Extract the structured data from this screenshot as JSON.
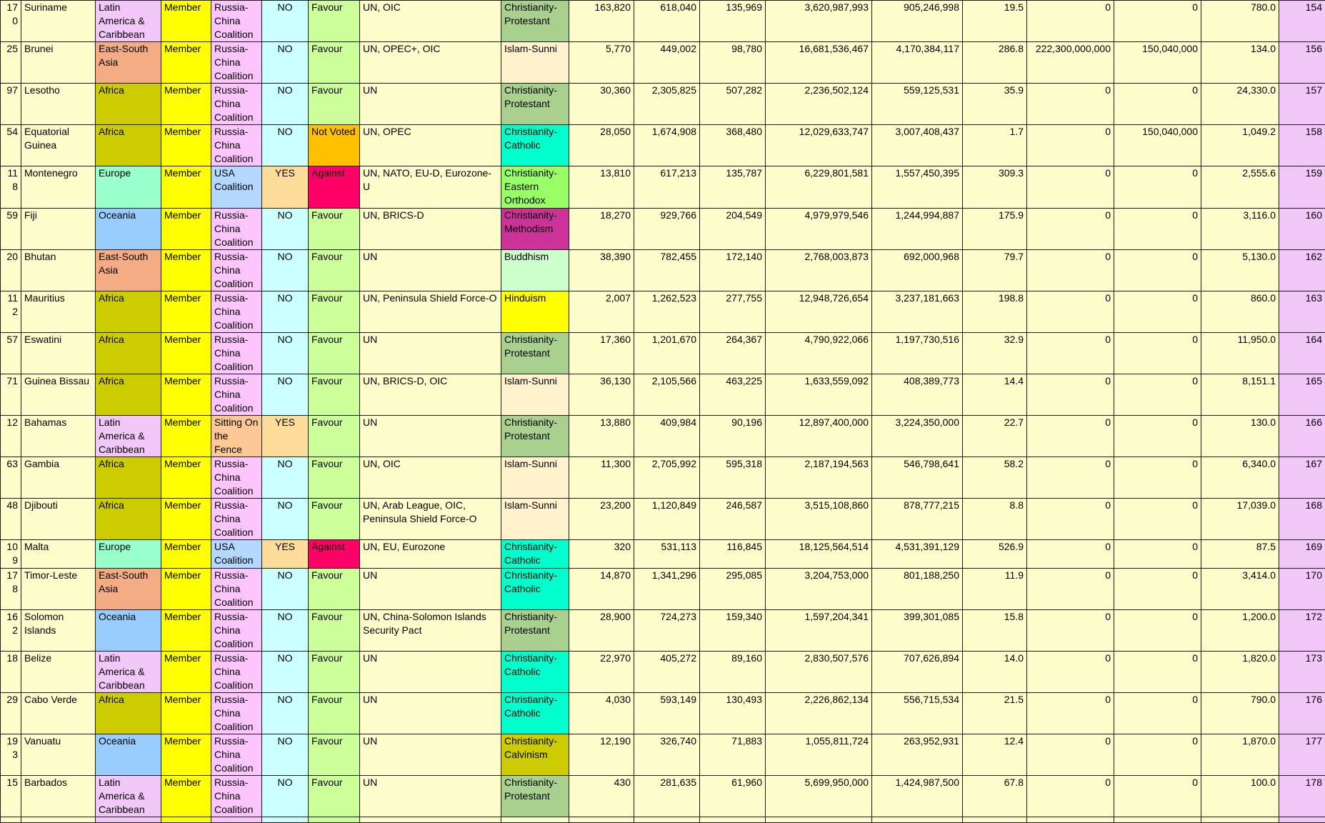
{
  "colors": {
    "cell_default": "#fdfdcb",
    "rank_column": "#f2c8f8",
    "region": {
      "Latin America & Caribbean": "#f2c8f8",
      "East-South Asia": "#f4ac84",
      "Africa": "#cccc00",
      "Europe": "#99ffcc",
      "Oceania": "#99ccff"
    },
    "membership": {
      "Member": "#ffff00"
    },
    "coalition": {
      "Russia-China Coalition": "#fcc6fc",
      "USA Coalition": "#b4d8ff",
      "Sitting On the Fence": "#fcc896"
    },
    "flag": {
      "NO": "#ccffff",
      "YES": "#fddd99"
    },
    "vote": {
      "Favour": "#ccff99",
      "Not Voted": "#ffc000",
      "Against": "#ff0066"
    },
    "religion": {
      "Christianity-Protestant": "#a9d08e",
      "Islam-Sunni": "#fff2cc",
      "Christianity-Catholic": "#00ffcc",
      "Christianity-Eastern Orthodox": "#99ff66",
      "Christianity-Methodism": "#cc3399",
      "Buddhism": "#ccffcc",
      "Hinduism": "#ffff00",
      "Christianity-Calvinism": "#cccc00"
    }
  },
  "rows": [
    {
      "id": "170",
      "country": "Suriname",
      "region": "Latin America & Caribbean",
      "membership": "Member",
      "coalition": "Russia-China Coalition",
      "flag": "NO",
      "vote": "Favour",
      "orgs": "UN, OIC",
      "religion": "Christianity-Protestant",
      "c1": "163,820",
      "c2": "618,040",
      "c3": "135,969",
      "c4": "3,620,987,993",
      "c5": "905,246,998",
      "c6": "19.5",
      "c7": "0",
      "c8": "0",
      "c9": "780.0",
      "rank": "154"
    },
    {
      "id": "25",
      "country": "Brunei",
      "region": "East-South Asia",
      "membership": "Member",
      "coalition": "Russia-China Coalition",
      "flag": "NO",
      "vote": "Favour",
      "orgs": "UN, OPEC+, OIC",
      "religion": "Islam-Sunni",
      "c1": "5,770",
      "c2": "449,002",
      "c3": "98,780",
      "c4": "16,681,536,467",
      "c5": "4,170,384,117",
      "c6": "286.8",
      "c7": "222,300,000,000",
      "c8": "150,040,000",
      "c9": "134.0",
      "rank": "156"
    },
    {
      "id": "97",
      "country": "Lesotho",
      "region": "Africa",
      "membership": "Member",
      "coalition": "Russia-China Coalition",
      "flag": "NO",
      "vote": "Favour",
      "orgs": "UN",
      "religion": "Christianity-Protestant",
      "c1": "30,360",
      "c2": "2,305,825",
      "c3": "507,282",
      "c4": "2,236,502,124",
      "c5": "559,125,531",
      "c6": "35.9",
      "c7": "0",
      "c8": "0",
      "c9": "24,330.0",
      "rank": "157"
    },
    {
      "id": "54",
      "country": "Equatorial Guinea",
      "region": "Africa",
      "membership": "Member",
      "coalition": "Russia-China Coalition",
      "flag": "NO",
      "vote": "Not Voted",
      "orgs": "UN, OPEC",
      "religion": "Christianity-Catholic",
      "c1": "28,050",
      "c2": "1,674,908",
      "c3": "368,480",
      "c4": "12,029,633,747",
      "c5": "3,007,408,437",
      "c6": "1.7",
      "c7": "0",
      "c8": "150,040,000",
      "c9": "1,049.2",
      "rank": "158"
    },
    {
      "id": "118",
      "country": "Montenegro",
      "region": "Europe",
      "membership": "Member",
      "coalition": "USA Coalition",
      "flag": "YES",
      "vote": "Against",
      "orgs": "UN, NATO, EU-D,  Eurozone-U",
      "religion": "Christianity-Eastern Orthodox",
      "c1": "13,810",
      "c2": "617,213",
      "c3": "135,787",
      "c4": "6,229,801,581",
      "c5": "1,557,450,395",
      "c6": "309.3",
      "c7": "0",
      "c8": "0",
      "c9": "2,555.6",
      "rank": "159",
      "tall": true
    },
    {
      "id": "59",
      "country": "Fiji",
      "region": "Oceania",
      "membership": "Member",
      "coalition": "Russia-China Coalition",
      "flag": "NO",
      "vote": "Favour",
      "orgs": "UN, BRICS-D",
      "religion": "Christianity-Methodism",
      "c1": "18,270",
      "c2": "929,766",
      "c3": "204,549",
      "c4": "4,979,979,546",
      "c5": "1,244,994,887",
      "c6": "175.9",
      "c7": "0",
      "c8": "0",
      "c9": "3,116.0",
      "rank": "160"
    },
    {
      "id": "20",
      "country": "Bhutan",
      "region": "East-South Asia",
      "membership": "Member",
      "coalition": "Russia-China Coalition",
      "flag": "NO",
      "vote": "Favour",
      "orgs": "UN",
      "religion": "Buddhism",
      "c1": "38,390",
      "c2": "782,455",
      "c3": "172,140",
      "c4": "2,768,003,873",
      "c5": "692,000,968",
      "c6": "79.7",
      "c7": "0",
      "c8": "0",
      "c9": "5,130.0",
      "rank": "162"
    },
    {
      "id": "112",
      "country": "Mauritius",
      "region": "Africa",
      "membership": "Member",
      "coalition": "Russia-China Coalition",
      "flag": "NO",
      "vote": "Favour",
      "orgs": "UN, Peninsula Shield Force-O",
      "religion": "Hinduism",
      "c1": "2,007",
      "c2": "1,262,523",
      "c3": "277,755",
      "c4": "12,948,726,654",
      "c5": "3,237,181,663",
      "c6": "198.8",
      "c7": "0",
      "c8": "0",
      "c9": "860.0",
      "rank": "163"
    },
    {
      "id": "57",
      "country": "Eswatini",
      "region": "Africa",
      "membership": "Member",
      "coalition": "Russia-China Coalition",
      "flag": "NO",
      "vote": "Favour",
      "orgs": "UN",
      "religion": "Christianity-Protestant",
      "c1": "17,360",
      "c2": "1,201,670",
      "c3": "264,367",
      "c4": "4,790,922,066",
      "c5": "1,197,730,516",
      "c6": "32.9",
      "c7": "0",
      "c8": "0",
      "c9": "11,950.0",
      "rank": "164"
    },
    {
      "id": "71",
      "country": "Guinea Bissau",
      "region": "Africa",
      "membership": "Member",
      "coalition": "Russia-China Coalition",
      "flag": "NO",
      "vote": "Favour",
      "orgs": "UN, BRICS-D, OIC",
      "religion": "Islam-Sunni",
      "c1": "36,130",
      "c2": "2,105,566",
      "c3": "463,225",
      "c4": "1,633,559,092",
      "c5": "408,389,773",
      "c6": "14.4",
      "c7": "0",
      "c8": "0",
      "c9": "8,151.1",
      "rank": "165"
    },
    {
      "id": "12",
      "country": "Bahamas",
      "region": "Latin America & Caribbean",
      "membership": "Member",
      "coalition": "Sitting On the Fence",
      "flag": "YES",
      "vote": "Favour",
      "orgs": "UN",
      "religion": "Christianity-Protestant",
      "c1": "13,880",
      "c2": "409,984",
      "c3": "90,196",
      "c4": "12,897,400,000",
      "c5": "3,224,350,000",
      "c6": "22.7",
      "c7": "0",
      "c8": "0",
      "c9": "130.0",
      "rank": "166"
    },
    {
      "id": "63",
      "country": "Gambia",
      "region": "Africa",
      "membership": "Member",
      "coalition": "Russia-China Coalition",
      "flag": "NO",
      "vote": "Favour",
      "orgs": "UN, OIC",
      "religion": "Islam-Sunni",
      "c1": "11,300",
      "c2": "2,705,992",
      "c3": "595,318",
      "c4": "2,187,194,563",
      "c5": "546,798,641",
      "c6": "58.2",
      "c7": "0",
      "c8": "0",
      "c9": "6,340.0",
      "rank": "167"
    },
    {
      "id": "48",
      "country": "Djibouti",
      "region": "Africa",
      "membership": "Member",
      "coalition": "Russia-China Coalition",
      "flag": "NO",
      "vote": "Favour",
      "orgs": "UN, Arab League, OIC, Peninsula Shield Force-O",
      "religion": "Islam-Sunni",
      "c1": "23,200",
      "c2": "1,120,849",
      "c3": "246,587",
      "c4": "3,515,108,860",
      "c5": "878,777,215",
      "c6": "8.8",
      "c7": "0",
      "c8": "0",
      "c9": "17,039.0",
      "rank": "168"
    },
    {
      "id": "109",
      "country": "Malta",
      "region": "Europe",
      "membership": "Member",
      "coalition": "USA Coalition",
      "flag": "YES",
      "vote": "Against",
      "orgs": "UN, EU, Eurozone",
      "religion": "Christianity-Catholic",
      "c1": "320",
      "c2": "531,113",
      "c3": "116,845",
      "c4": "18,125,564,514",
      "c5": "4,531,391,129",
      "c6": "526.9",
      "c7": "0",
      "c8": "0",
      "c9": "87.5",
      "rank": "169"
    },
    {
      "id": "178",
      "country": "Timor-Leste",
      "region": "East-South Asia",
      "membership": "Member",
      "coalition": "Russia-China Coalition",
      "flag": "NO",
      "vote": "Favour",
      "orgs": "UN",
      "religion": "Christianity-Catholic",
      "c1": "14,870",
      "c2": "1,341,296",
      "c3": "295,085",
      "c4": "3,204,753,000",
      "c5": "801,188,250",
      "c6": "11.9",
      "c7": "0",
      "c8": "0",
      "c9": "3,414.0",
      "rank": "170"
    },
    {
      "id": "162",
      "country": "Solomon Islands",
      "region": "Oceania",
      "membership": "Member",
      "coalition": "Russia-China Coalition",
      "flag": "NO",
      "vote": "Favour",
      "orgs": "UN, China-Solomon Islands Security Pact",
      "religion": "Christianity-Protestant",
      "c1": "28,900",
      "c2": "724,273",
      "c3": "159,340",
      "c4": "1,597,204,341",
      "c5": "399,301,085",
      "c6": "15.8",
      "c7": "0",
      "c8": "0",
      "c9": "1,200.0",
      "rank": "172"
    },
    {
      "id": "18",
      "country": "Belize",
      "region": "Latin America & Caribbean",
      "membership": "Member",
      "coalition": "Russia-China Coalition",
      "flag": "NO",
      "vote": "Favour",
      "orgs": "UN",
      "religion": "Christianity-Catholic",
      "c1": "22,970",
      "c2": "405,272",
      "c3": "89,160",
      "c4": "2,830,507,576",
      "c5": "707,626,894",
      "c6": "14.0",
      "c7": "0",
      "c8": "0",
      "c9": "1,820.0",
      "rank": "173"
    },
    {
      "id": "29",
      "country": "Cabo Verde",
      "region": "Africa",
      "membership": "Member",
      "coalition": "Russia-China Coalition",
      "flag": "NO",
      "vote": "Favour",
      "orgs": "UN",
      "religion": "Christianity-Catholic",
      "c1": "4,030",
      "c2": "593,149",
      "c3": "130,493",
      "c4": "2,226,862,134",
      "c5": "556,715,534",
      "c6": "21.5",
      "c7": "0",
      "c8": "0",
      "c9": "790.0",
      "rank": "176"
    },
    {
      "id": "193",
      "country": "Vanuatu",
      "region": "Oceania",
      "membership": "Member",
      "coalition": "Russia-China Coalition",
      "flag": "NO",
      "vote": "Favour",
      "orgs": "UN",
      "religion": "Christianity-Calvinism",
      "c1": "12,190",
      "c2": "326,740",
      "c3": "71,883",
      "c4": "1,055,811,724",
      "c5": "263,952,931",
      "c6": "12.4",
      "c7": "0",
      "c8": "0",
      "c9": "1,870.0",
      "rank": "177"
    },
    {
      "id": "15",
      "country": "Barbados",
      "region": "Latin America & Caribbean",
      "membership": "Member",
      "coalition": "Russia-China Coalition",
      "flag": "NO",
      "vote": "Favour",
      "orgs": "UN",
      "religion": "Christianity-Protestant",
      "c1": "430",
      "c2": "281,635",
      "c3": "61,960",
      "c4": "5,699,950,000",
      "c5": "1,424,987,500",
      "c6": "67.8",
      "c7": "0",
      "c8": "0",
      "c9": "100.0",
      "rank": "178"
    }
  ]
}
